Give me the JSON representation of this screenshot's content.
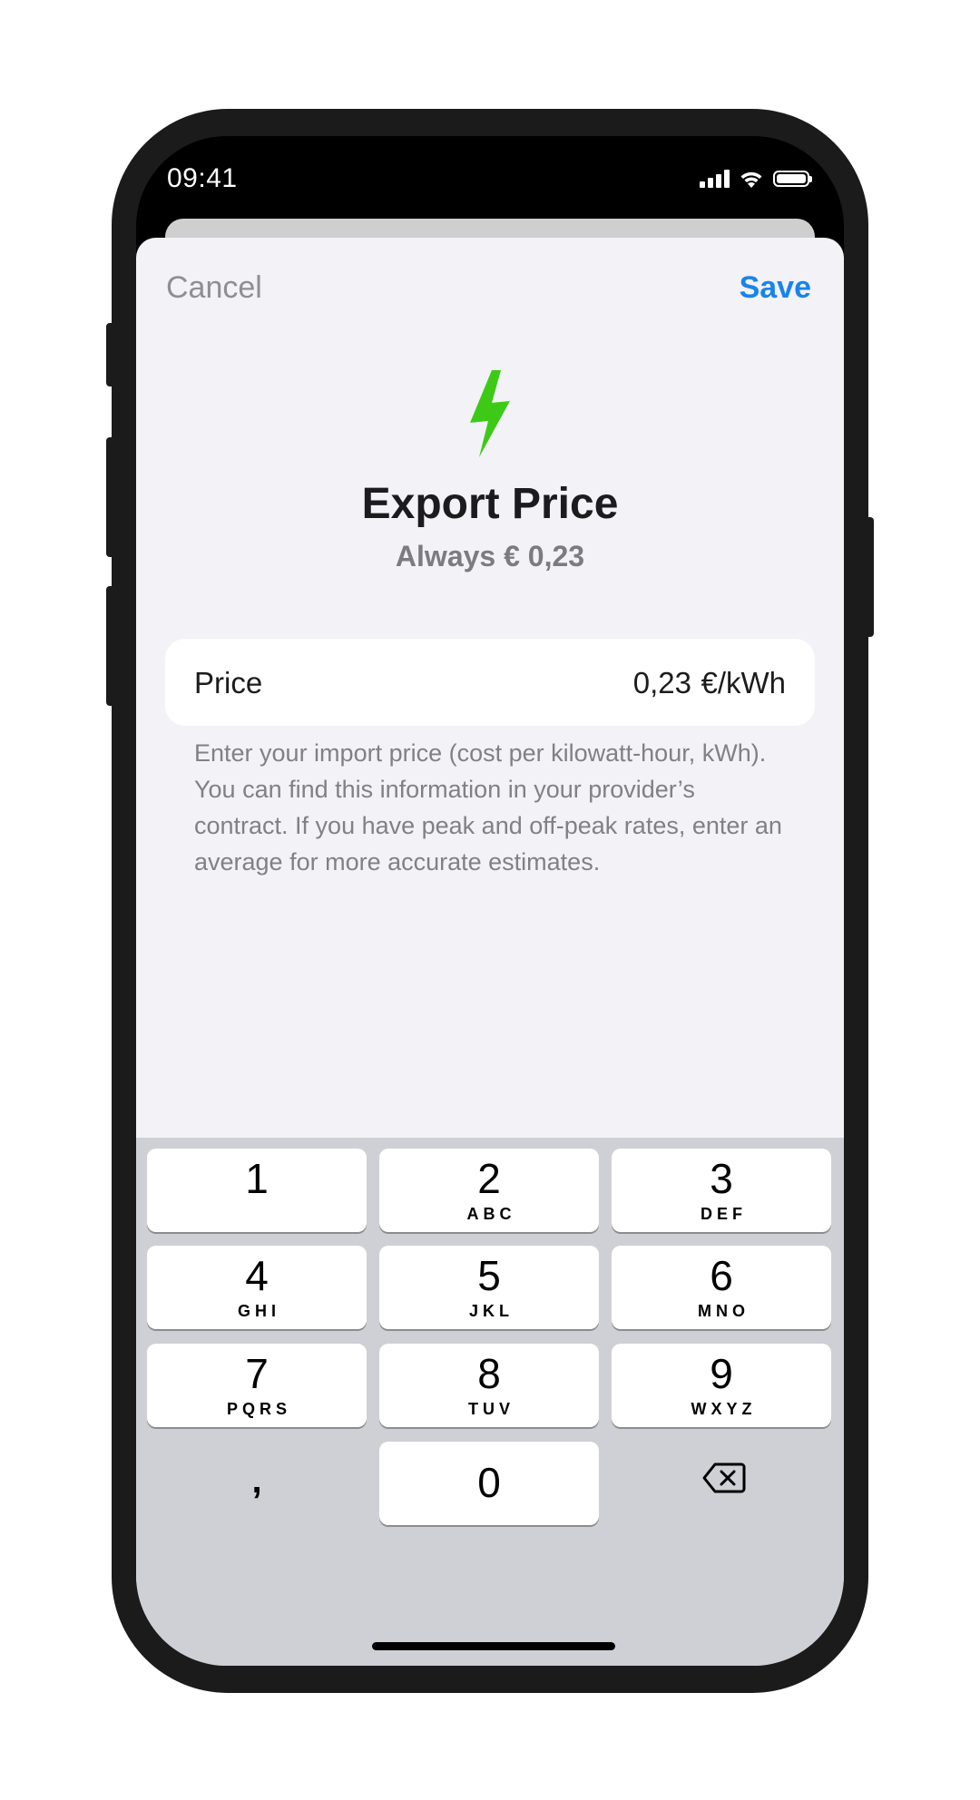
{
  "status_bar": {
    "time": "09:41"
  },
  "nav": {
    "cancel_label": "Cancel",
    "save_label": "Save"
  },
  "header": {
    "title": "Export Price",
    "subtitle": "Always € 0,23",
    "icon": "bolt-icon",
    "icon_color": "#3dca17"
  },
  "price_field": {
    "label": "Price",
    "value": "0,23",
    "unit": "€/kWh"
  },
  "help_text": "Enter your import price (cost per kilowatt-hour, kWh). You can find this information in your provider’s contract. If you have peak and off-peak rates, enter an average for more accurate estimates.",
  "keypad": {
    "keys": [
      {
        "digit": "1",
        "letters": ""
      },
      {
        "digit": "2",
        "letters": "ABC"
      },
      {
        "digit": "3",
        "letters": "DEF"
      },
      {
        "digit": "4",
        "letters": "GHI"
      },
      {
        "digit": "5",
        "letters": "JKL"
      },
      {
        "digit": "6",
        "letters": "MNO"
      },
      {
        "digit": "7",
        "letters": "PQRS"
      },
      {
        "digit": "8",
        "letters": "TUV"
      },
      {
        "digit": "9",
        "letters": "WXYZ"
      }
    ],
    "comma": ",",
    "zero": "0",
    "delete_icon": "delete-backspace-icon"
  },
  "colors": {
    "accent": "#1a84e8",
    "bolt": "#3dca17",
    "sheet_bg": "#f2f2f7",
    "keyboard_bg": "#cfd0d5"
  }
}
